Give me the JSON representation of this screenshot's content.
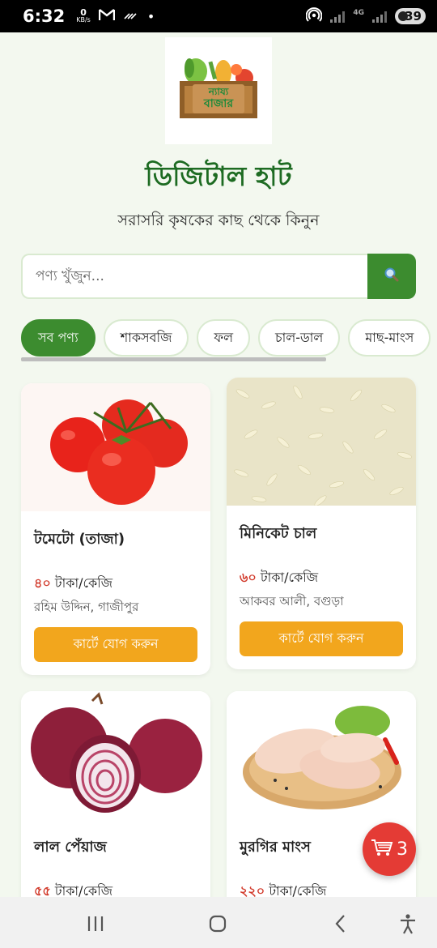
{
  "status_bar": {
    "time": "6:32",
    "net_speed": "0",
    "net_unit": "KB/s",
    "mail_icon": "gmail-icon",
    "network_type": "4G",
    "battery": "39"
  },
  "header": {
    "logo_text_top": "ন্যায্য",
    "logo_text_bottom": "বাজার",
    "title": "ডিজিটাল হাট",
    "subtitle": "সরাসরি কৃষকের কাছ থেকে কিনুন"
  },
  "search": {
    "placeholder": "পণ্য খুঁজুন...",
    "button_icon": "search-icon"
  },
  "categories": [
    {
      "label": "সব পণ্য",
      "active": true
    },
    {
      "label": "শাকসবজি",
      "active": false
    },
    {
      "label": "ফল",
      "active": false
    },
    {
      "label": "চাল-ডাল",
      "active": false
    },
    {
      "label": "মাছ-মাংস",
      "active": false
    }
  ],
  "products": [
    {
      "name": "টমেটো (তাজা)",
      "price": "৪০",
      "unit": "টাকা/কেজি",
      "seller": "রহিম উদ্দিন, গাজীপুর",
      "button": "কার্টে যোগ করুন",
      "image_icon": "tomato-image"
    },
    {
      "name": "মিনিকেট চাল",
      "price": "৬০",
      "unit": "টাকা/কেজি",
      "seller": "আকবর আলী, বগুড়া",
      "button": "কার্টে যোগ করুন",
      "image_icon": "rice-image"
    },
    {
      "name": "লাল পেঁয়াজ",
      "price": "৫৫",
      "unit": "টাকা/কেজি",
      "seller": "",
      "button": "",
      "image_icon": "onion-image"
    },
    {
      "name": "মুরগির মাংস",
      "price": "২২০",
      "unit": "টাকা/কেজি",
      "seller": "",
      "button": "",
      "image_icon": "chicken-image"
    }
  ],
  "cart": {
    "count": "3",
    "icon": "cart-icon"
  },
  "nav": {
    "recents_icon": "recents-icon",
    "home_icon": "home-icon",
    "back_icon": "back-icon",
    "accessibility_icon": "accessibility-icon"
  },
  "colors": {
    "primary_green": "#3c8c2f",
    "title_green": "#1d6b22",
    "accent_orange": "#f2a61d",
    "price_red": "#d23b2c",
    "cart_red": "#e43b35",
    "background": "#f3f8ef"
  }
}
